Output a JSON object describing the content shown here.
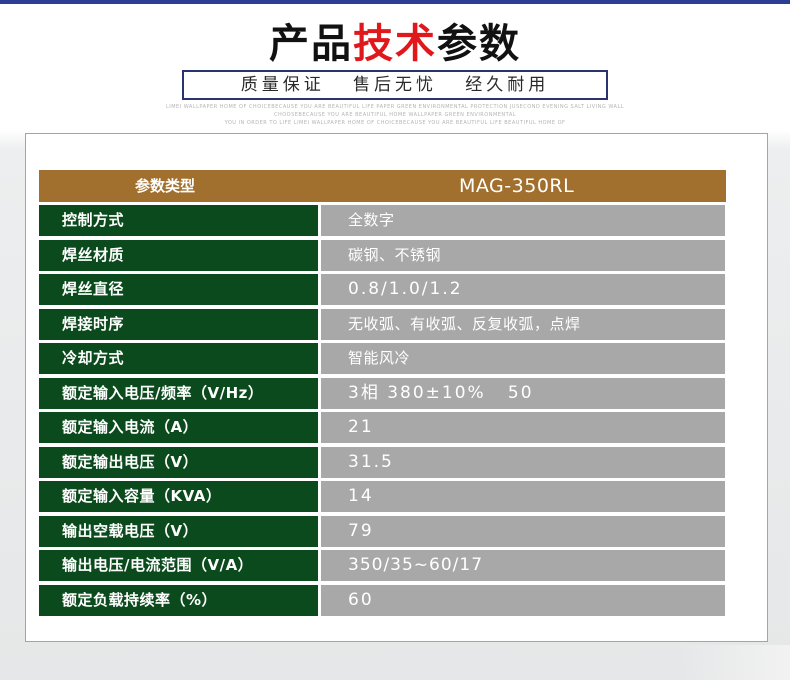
{
  "header": {
    "title_part1": "产品",
    "title_part2": "技术",
    "title_part3": "参数",
    "slogan": "质量保证   售后无忧   经久耐用",
    "fine_print": [
      "LIMEI WALLPAPER HOME OF CHOICEBECAUSE YOU ARE BEAUTIFUL LIFE PAPER GREEN ENVIRONMENTAL PROTECTION JUSECOND EVENING SALT LIVING WALL",
      "CHOOSEBECAUSE YOU ARE BEAUTIFUL HOME WALLPAPER GREEN ENVIRONMENTAL",
      "YOU IN ORDER TO LIFE LIMEI WALLPAPER HOME OF CHOICEBECAUSE YOU ARE BEAUTIFUL LIFE BEAUTIFUL HOME OF"
    ]
  },
  "table": {
    "header": {
      "name": "参数类型",
      "value": "MAG-350RL"
    },
    "rows": [
      {
        "name": "控制方式",
        "value": "全数字"
      },
      {
        "name": "焊丝材质",
        "value": "碳钢、不锈钢"
      },
      {
        "name": "焊丝直径",
        "value": "0.8/1.0/1.2"
      },
      {
        "name": "焊接时序",
        "value": "无收弧、有收弧、反复收弧，点焊"
      },
      {
        "name": "冷却方式",
        "value": "智能风冷"
      },
      {
        "name": "额定输入电压/频率（V/Hz）",
        "value": "3相 380±10%   50"
      },
      {
        "name": "额定输入电流（A）",
        "value": "21"
      },
      {
        "name": "额定输出电压（V）",
        "value": "31.5"
      },
      {
        "name": "额定输入容量（KVA）",
        "value": "14"
      },
      {
        "name": "输出空载电压（V）",
        "value": "79"
      },
      {
        "name": "输出电压/电流范围（V/A）",
        "value": "350/35~60/17"
      },
      {
        "name": "额定负载持续率（%）",
        "value": "60"
      }
    ]
  }
}
